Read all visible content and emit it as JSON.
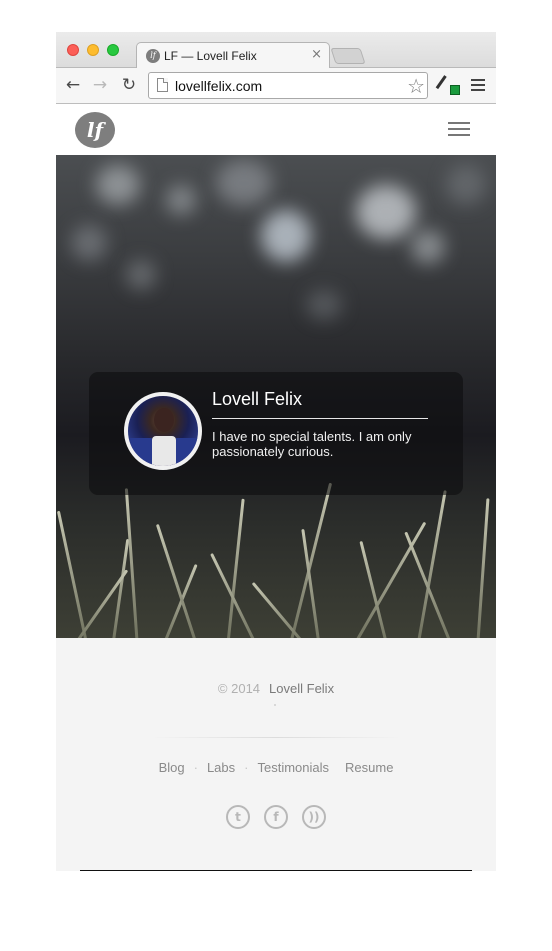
{
  "browser": {
    "tab_title": "LF — Lovell Felix",
    "tab_favicon_text": "lf",
    "tab_close": "×",
    "url": "lovellfelix.com",
    "back_glyph": "←",
    "forward_glyph": "→",
    "reload_glyph": "↻",
    "star_glyph": "☆",
    "icons": [
      "back-arrow-icon",
      "forward-arrow-icon",
      "reload-icon",
      "page-icon",
      "bookmark-star-icon",
      "eyedropper-extension-icon",
      "menu-icon"
    ]
  },
  "site": {
    "logo_text": "lf"
  },
  "profile": {
    "name": "Lovell Felix",
    "tagline": "I have no special talents. I am only passionately curious."
  },
  "footer": {
    "copyright": "© 2014",
    "owner": "Lovell Felix",
    "nav": {
      "blog": "Blog",
      "labs": "Labs",
      "testimonials": "Testimonials",
      "resume": "Resume",
      "separator": "·"
    },
    "social": {
      "twitter_glyph": "t",
      "facebook_glyph": "f",
      "rss_glyph": "))",
      "icons": [
        "twitter-icon",
        "facebook-icon",
        "rss-icon"
      ]
    }
  },
  "colors": {
    "footer_bg": "#f4f4f4",
    "card_bg": "rgba(12,12,14,0.58)",
    "logo_bg": "#7e7e7e"
  }
}
